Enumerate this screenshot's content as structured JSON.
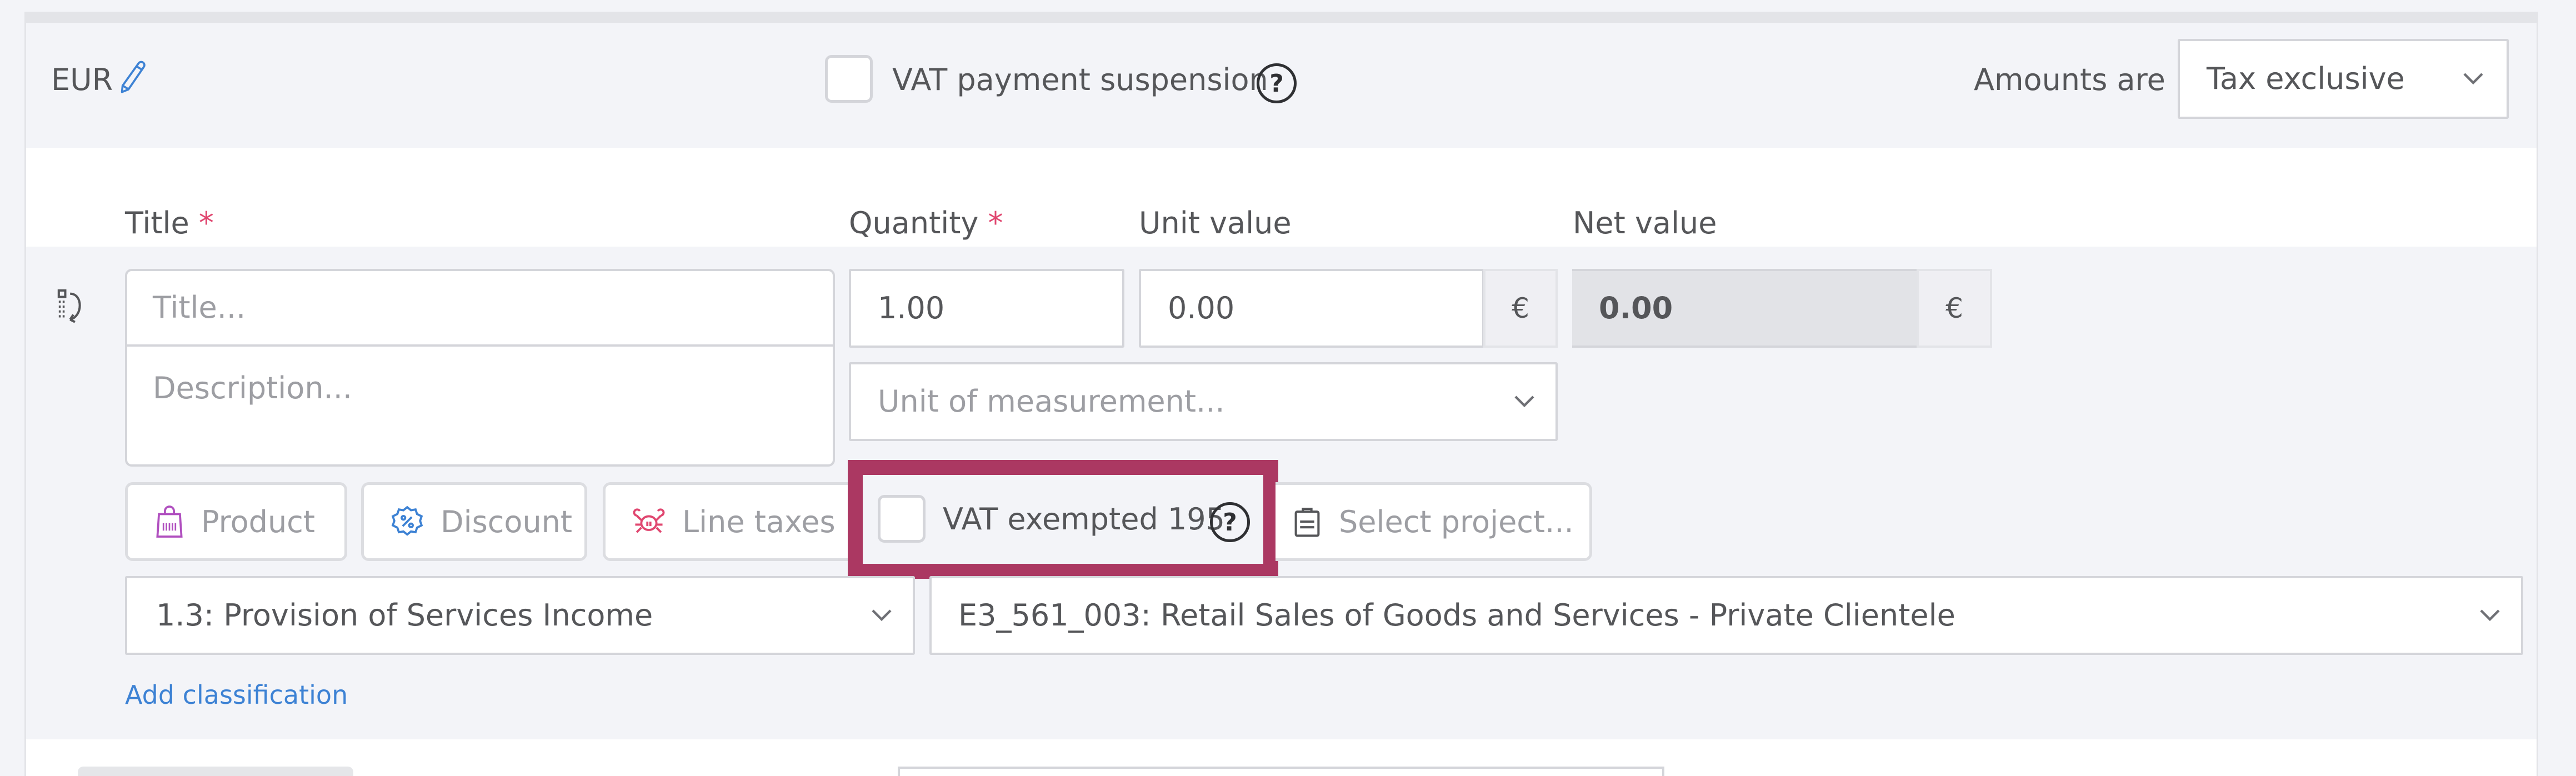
{
  "header": {
    "currency": "EUR",
    "vat_payment_suspension_label": "VAT payment suspension",
    "vat_payment_suspension_checked": false,
    "amounts_are_label": "Amounts are",
    "amounts_are_value": "Tax exclusive"
  },
  "columns": {
    "title": "Title",
    "quantity": "Quantity",
    "unit_value": "Unit value",
    "net_value": "Net value",
    "required_marker": "*"
  },
  "line": {
    "title_placeholder": "Title...",
    "description_placeholder": "Description...",
    "quantity": "1.00",
    "unit_value": "0.00",
    "unit_currency": "€",
    "net_value": "0.00",
    "net_currency": "€",
    "unit_of_measurement_placeholder": "Unit of measurement..."
  },
  "actions": {
    "product": "Product",
    "discount": "Discount",
    "line_taxes": "Line taxes",
    "vat_exempted_label": "VAT exempted 195",
    "vat_exempted_checked": false,
    "select_project_placeholder": "Select project..."
  },
  "classification": {
    "category": "1.3: Provision of Services Income",
    "type": "E3_561_003: Retail Sales of Goods and Services - Private Clientele",
    "add_label": "Add classification"
  },
  "colors": {
    "highlight": "#ab3862",
    "required": "#e0466f",
    "link": "#3d82d4",
    "product_icon": "#b04fbf",
    "discount_icon": "#3d82d4",
    "line_taxes_icon": "#e0466f"
  }
}
